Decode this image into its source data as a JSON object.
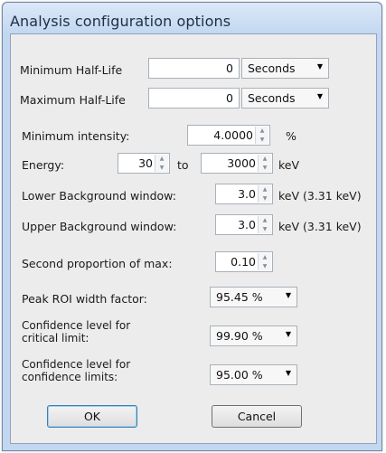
{
  "window": {
    "title": "Analysis configuration options"
  },
  "form": {
    "min_half_life": {
      "label": "Minimum Half-Life",
      "value": "0",
      "unit": "Seconds"
    },
    "max_half_life": {
      "label": "Maximum Half-Life",
      "value": "0",
      "unit": "Seconds"
    },
    "min_intensity": {
      "label": "Minimum intensity:",
      "value": "4.0000",
      "unit": "%"
    },
    "energy": {
      "label": "Energy:",
      "from": "30",
      "to_label": "to",
      "to": "3000",
      "unit": "keV"
    },
    "lower_bg": {
      "label": "Lower Background window:",
      "value": "3.0",
      "unit": "keV (3.31 keV)"
    },
    "upper_bg": {
      "label": "Upper Background window:",
      "value": "3.0",
      "unit": "keV (3.31 keV)"
    },
    "second_prop": {
      "label": "Second proportion of max:",
      "value": "0.10"
    },
    "peak_roi": {
      "label": "Peak ROI width factor:",
      "value": "95.45 %"
    },
    "conf_critical": {
      "label": "Confidence level for critical limit:",
      "value": "99.90 %"
    },
    "conf_limits": {
      "label": "Confidence level for confidence limits:",
      "value": "95.00 %"
    }
  },
  "buttons": {
    "ok": "OK",
    "cancel": "Cancel"
  }
}
